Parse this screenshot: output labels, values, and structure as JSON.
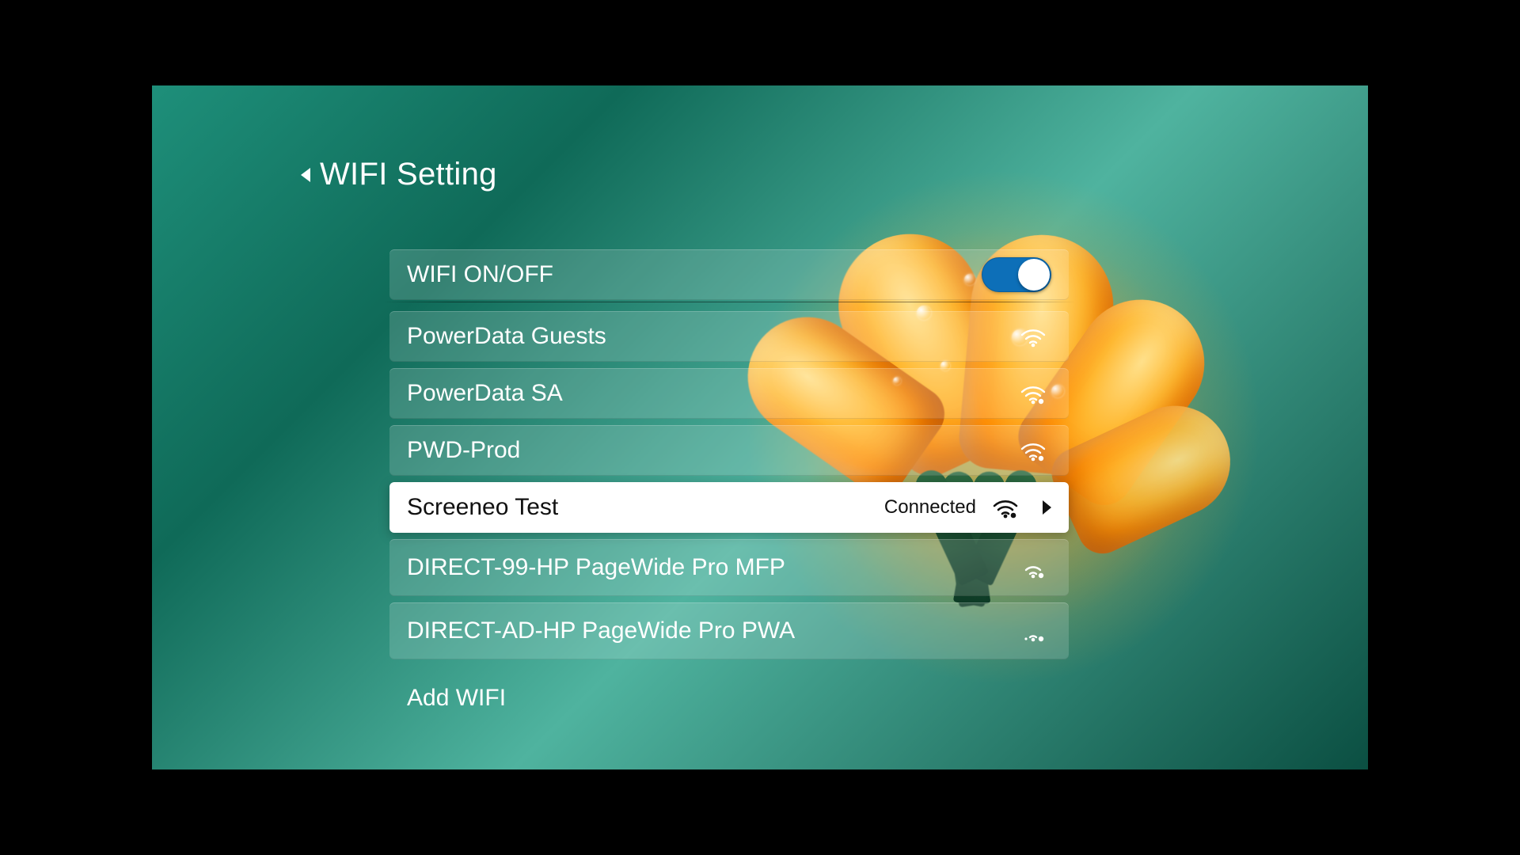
{
  "title": "WIFI Setting",
  "wifi_toggle": {
    "label": "WIFI ON/OFF",
    "on": true
  },
  "connected_label": "Connected",
  "networks": [
    {
      "ssid": "PowerData Guests",
      "secured": false,
      "signal": 3,
      "connected": false
    },
    {
      "ssid": "PowerData SA",
      "secured": true,
      "signal": 3,
      "connected": false
    },
    {
      "ssid": "PWD-Prod",
      "secured": true,
      "signal": 3,
      "connected": false
    },
    {
      "ssid": "Screeneo Test",
      "secured": true,
      "signal": 3,
      "connected": true
    },
    {
      "ssid": "DIRECT-99-HP PageWide Pro MFP",
      "secured": true,
      "signal": 2,
      "connected": false
    },
    {
      "ssid": "DIRECT-AD-HP PageWide Pro PWA",
      "secured": true,
      "signal": 1,
      "connected": false
    }
  ],
  "add_wifi_label": "Add WIFI"
}
